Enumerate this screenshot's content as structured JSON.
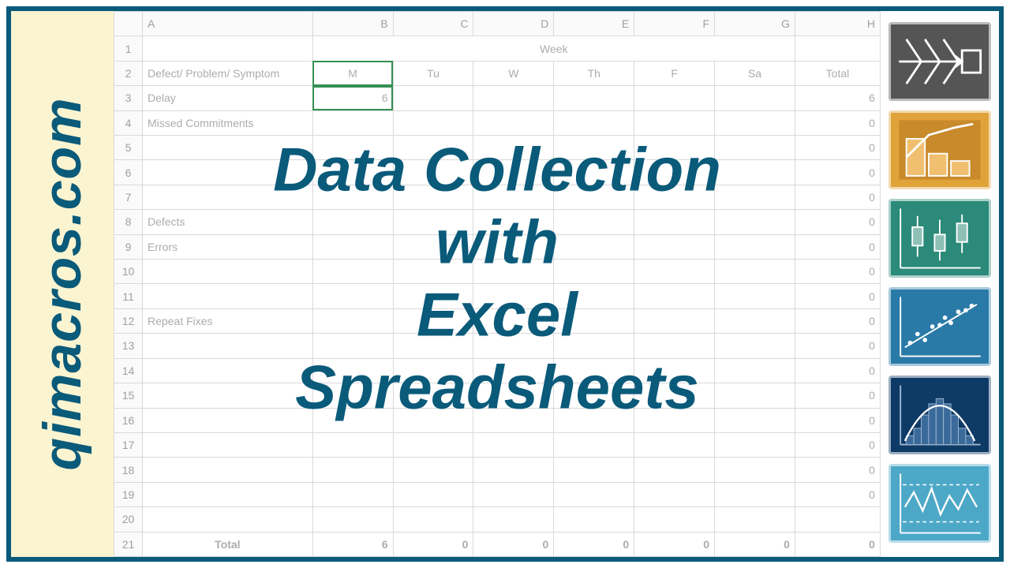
{
  "brand": "qimacros.com",
  "overlay": {
    "line1": "Data Collection",
    "line2": "with",
    "line3": "Excel",
    "line4": "Spreadsheets"
  },
  "columns": [
    "",
    "A",
    "B",
    "C",
    "D",
    "E",
    "F",
    "G",
    "H"
  ],
  "week_header": "Week",
  "header2": {
    "a": "Defect/ Problem/ Symptom",
    "b": "M",
    "c": "Tu",
    "d": "W",
    "e": "Th",
    "f": "F",
    "g": "Sa",
    "h": "Total"
  },
  "rows": [
    {
      "n": "3",
      "a": "Delay",
      "b": "6",
      "h": "6"
    },
    {
      "n": "4",
      "a": "Missed Commitments",
      "h": "0"
    },
    {
      "n": "5",
      "a": "",
      "h": "0"
    },
    {
      "n": "6",
      "a": "",
      "h": "0"
    },
    {
      "n": "7",
      "a": "",
      "h": "0"
    },
    {
      "n": "8",
      "a": "Defects",
      "h": "0"
    },
    {
      "n": "9",
      "a": "Errors",
      "h": "0"
    },
    {
      "n": "10",
      "a": "",
      "h": "0"
    },
    {
      "n": "11",
      "a": "",
      "h": "0"
    },
    {
      "n": "12",
      "a": "Repeat Fixes",
      "h": "0"
    },
    {
      "n": "13",
      "a": "",
      "h": "0"
    },
    {
      "n": "14",
      "a": "",
      "h": "0"
    },
    {
      "n": "15",
      "a": "",
      "h": "0"
    },
    {
      "n": "16",
      "a": "",
      "h": "0"
    },
    {
      "n": "17",
      "a": "",
      "h": "0"
    },
    {
      "n": "18",
      "a": "",
      "h": "0"
    },
    {
      "n": "19",
      "a": "",
      "h": "0"
    },
    {
      "n": "20",
      "a": "",
      "h": ""
    }
  ],
  "total_row": {
    "n": "21",
    "a": "Total",
    "b": "6",
    "c": "0",
    "d": "0",
    "e": "0",
    "f": "0",
    "g": "0",
    "h": "0"
  },
  "icons": {
    "fishbone": "fishbone-chart-icon",
    "pareto": "pareto-chart-icon",
    "boxplot": "box-plot-icon",
    "scatter": "scatter-plot-icon",
    "histogram": "histogram-icon",
    "control": "control-chart-icon"
  }
}
